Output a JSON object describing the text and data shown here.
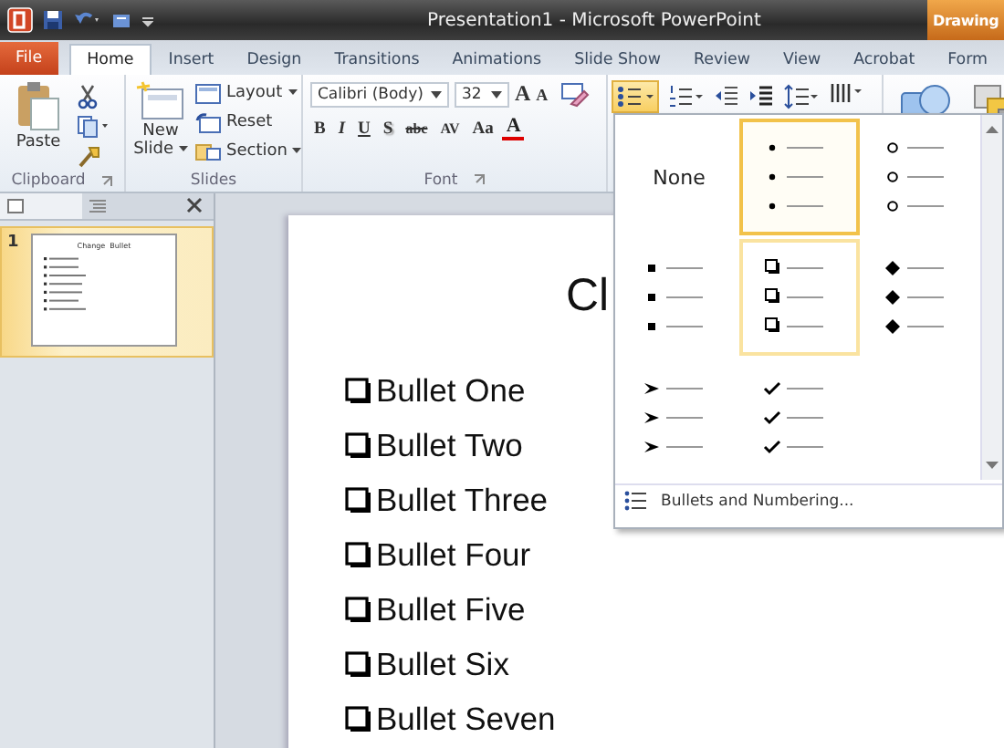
{
  "window": {
    "title": "Presentation1 - Microsoft PowerPoint"
  },
  "context_tab": "Drawing",
  "tabs": [
    {
      "label": "File",
      "kind": "file",
      "selected": false
    },
    {
      "label": "Home",
      "kind": "tab",
      "selected": true
    },
    {
      "label": "Insert",
      "kind": "tab",
      "selected": false
    },
    {
      "label": "Design",
      "kind": "tab",
      "selected": false
    },
    {
      "label": "Transitions",
      "kind": "tab",
      "selected": false
    },
    {
      "label": "Animations",
      "kind": "tab",
      "selected": false
    },
    {
      "label": "Slide Show",
      "kind": "tab",
      "selected": false
    },
    {
      "label": "Review",
      "kind": "tab",
      "selected": false
    },
    {
      "label": "View",
      "kind": "tab",
      "selected": false
    },
    {
      "label": "Acrobat",
      "kind": "tab",
      "selected": false
    },
    {
      "label": "Form",
      "kind": "tab",
      "selected": false
    }
  ],
  "clipboard": {
    "paste": "Paste",
    "label": "Clipboard"
  },
  "slides_group": {
    "new_slide": "New Slide",
    "layout": "Layout",
    "reset": "Reset",
    "section": "Section",
    "label": "Slides"
  },
  "font": {
    "name": "Calibri (Body)",
    "size": "32",
    "size_buttons": [
      "A",
      "A"
    ],
    "format_buttons": [
      "B",
      "I",
      "U",
      "S",
      "abc",
      "AV",
      "Aa",
      "A"
    ],
    "label": "Font"
  },
  "slide_pane": {
    "number": "1",
    "thumbnail_title": "Change  Bullet"
  },
  "slide": {
    "title": "Cl",
    "bullets": [
      "Bullet One",
      "Bullet Two",
      "Bullet Three",
      "Bullet Four",
      "Bullet Five",
      "Bullet Six",
      "Bullet Seven"
    ]
  },
  "bullet_gallery": {
    "cells": [
      {
        "kind": "none",
        "label": "None",
        "selected": false,
        "hovered": false
      },
      {
        "kind": "dot",
        "selected": true,
        "hovered": false
      },
      {
        "kind": "circle",
        "selected": false,
        "hovered": false
      },
      {
        "kind": "square",
        "selected": false,
        "hovered": false
      },
      {
        "kind": "hollowsquare",
        "selected": false,
        "hovered": true
      },
      {
        "kind": "diamond",
        "selected": false,
        "hovered": false
      },
      {
        "kind": "arrow",
        "selected": false,
        "hovered": false
      },
      {
        "kind": "check",
        "selected": false,
        "hovered": false
      }
    ],
    "footer": "Bullets and Numbering..."
  }
}
